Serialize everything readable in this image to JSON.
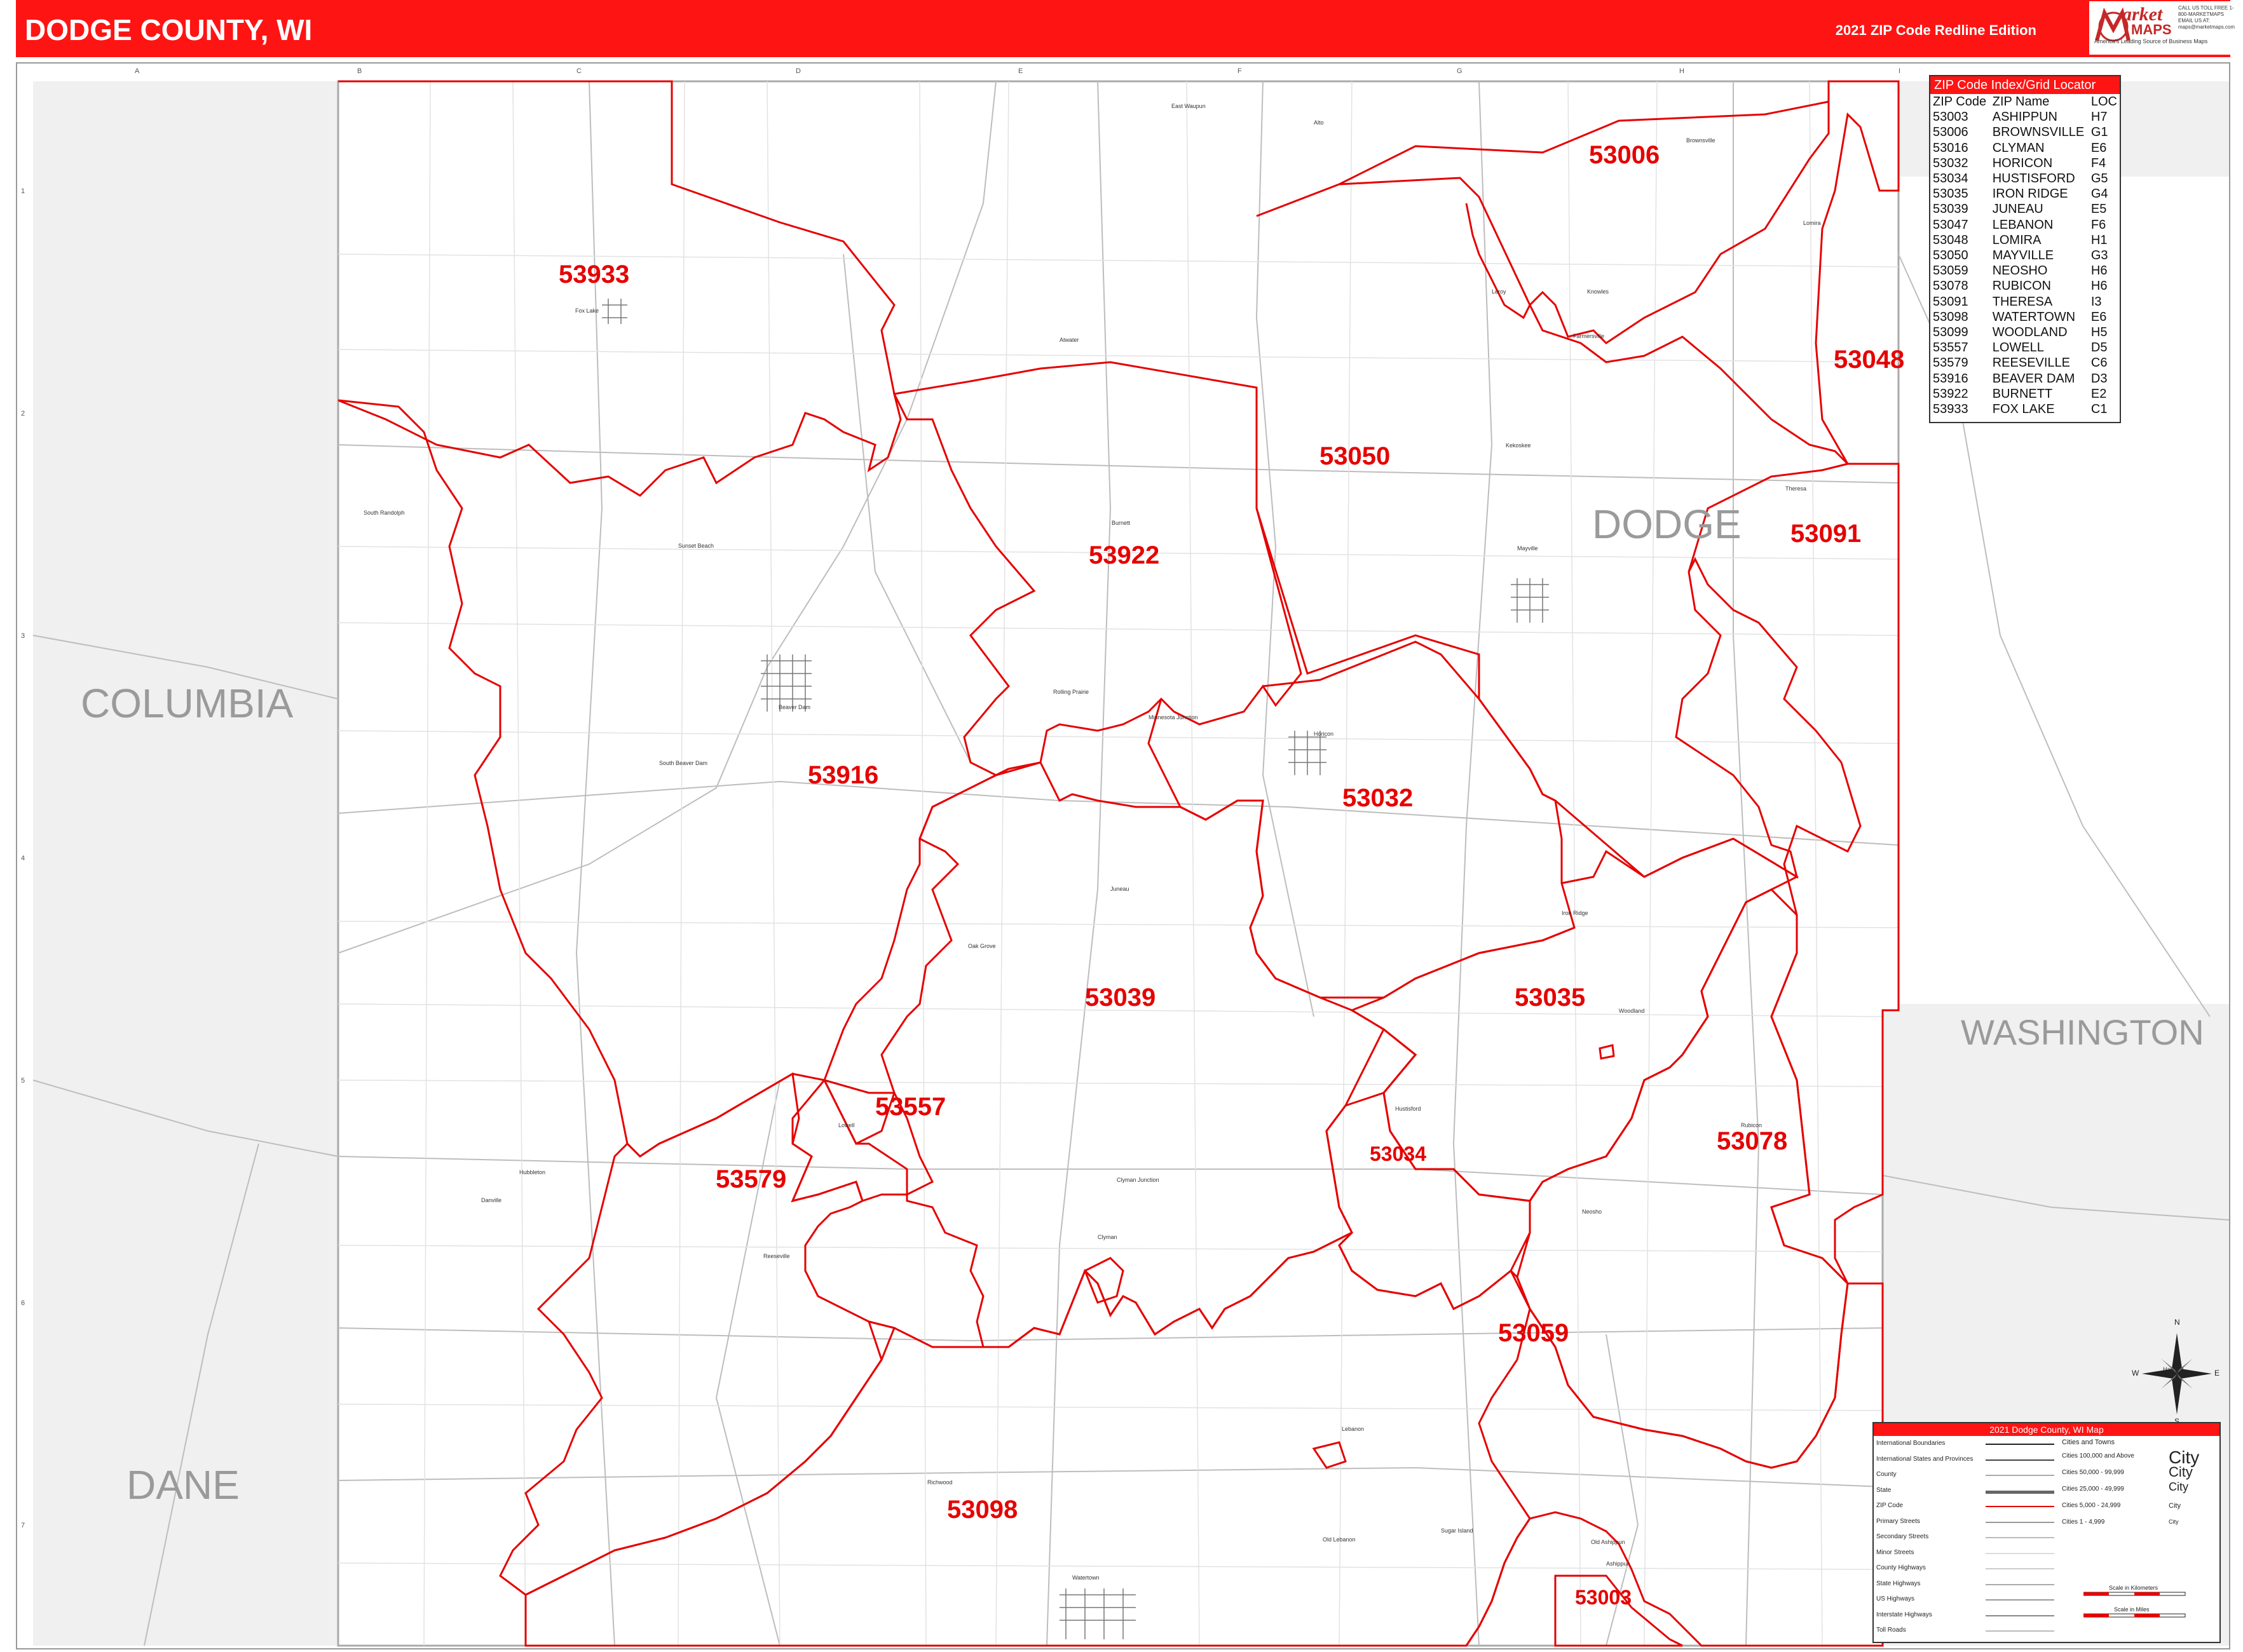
{
  "header": {
    "title": "DODGE COUNTY, WI",
    "edition": "2021 ZIP Code Redline Edition",
    "brand_word": "arket",
    "brand_maps": "MAPS",
    "brand_tagline": "America's Leading Source of Business Maps",
    "brand_info": "CALL US TOLL FREE 1-800-MARKETMAPS EMAIL US AT: maps@marketmaps.com"
  },
  "colors": {
    "accent": "#ff1414",
    "zip_boundary": "#e60000",
    "county_label": "#9a9a9a"
  },
  "counties": {
    "columbia": "COLUMBIA",
    "dodge": "DODGE",
    "washington": "WASHINGTON",
    "dane": "DANE"
  },
  "zips": [
    "53933",
    "53006",
    "53048",
    "53050",
    "53091",
    "53922",
    "53916",
    "53032",
    "53039",
    "53035",
    "53557",
    "53579",
    "53034",
    "53078",
    "53059",
    "53098",
    "53003"
  ],
  "cities": [
    "Fox Lake",
    "Beaver Dam",
    "South Beaver Dam",
    "South Randolph",
    "Sunset Beach",
    "Rolling Prairie",
    "Minnesota Junction",
    "Burnett",
    "Horicon",
    "Juneau",
    "Oak Grove",
    "Iron Ridge",
    "Mayville",
    "Theresa",
    "Lomira",
    "Brownsville",
    "Knowles",
    "Leroy",
    "Kekoskee",
    "Farmersville",
    "Neosho",
    "Rubicon",
    "Hustisford",
    "Clyman",
    "Clyman Junction",
    "Lowell",
    "Reeseville",
    "Danville",
    "Hubbleton",
    "Lebanon",
    "Old Lebanon",
    "Old Ashippun",
    "Ashippun",
    "Watertown",
    "Richwood",
    "Sugar Island",
    "East Waupun",
    "Alto",
    "Woodland",
    "Atwater",
    "Hartford"
  ],
  "grid": {
    "columns": [
      "A",
      "B",
      "C",
      "D",
      "E",
      "F",
      "G",
      "H",
      "I"
    ],
    "rows": [
      "1",
      "2",
      "3",
      "4",
      "5",
      "6",
      "7"
    ]
  },
  "index": {
    "title": "ZIP Code Index/Grid Locator",
    "headers": [
      "ZIP Code",
      "ZIP Name",
      "LOC"
    ],
    "rows": [
      [
        "53003",
        "ASHIPPUN",
        "H7"
      ],
      [
        "53006",
        "BROWNSVILLE",
        "G1"
      ],
      [
        "53016",
        "CLYMAN",
        "E6"
      ],
      [
        "53032",
        "HORICON",
        "F4"
      ],
      [
        "53034",
        "HUSTISFORD",
        "G5"
      ],
      [
        "53035",
        "IRON RIDGE",
        "G4"
      ],
      [
        "53039",
        "JUNEAU",
        "E5"
      ],
      [
        "53047",
        "LEBANON",
        "F6"
      ],
      [
        "53048",
        "LOMIRA",
        "H1"
      ],
      [
        "53050",
        "MAYVILLE",
        "G3"
      ],
      [
        "53059",
        "NEOSHO",
        "H6"
      ],
      [
        "53078",
        "RUBICON",
        "H6"
      ],
      [
        "53091",
        "THERESA",
        "I3"
      ],
      [
        "53098",
        "WATERTOWN",
        "E6"
      ],
      [
        "53099",
        "WOODLAND",
        "H5"
      ],
      [
        "53557",
        "LOWELL",
        "D5"
      ],
      [
        "53579",
        "REESEVILLE",
        "C6"
      ],
      [
        "53916",
        "BEAVER DAM",
        "D3"
      ],
      [
        "53922",
        "BURNETT",
        "E2"
      ],
      [
        "53933",
        "FOX LAKE",
        "C1"
      ]
    ]
  },
  "legend": {
    "title": "2021 Dodge County, WI Map",
    "lines": [
      "International Boundaries",
      "International States and Provinces",
      "County",
      "State",
      "ZIP Code",
      "Primary Streets",
      "Secondary Streets",
      "Minor Streets",
      "County Highways",
      "State Highways",
      "US Highways",
      "Interstate Highways",
      "Toll Roads"
    ],
    "city_header": "Cities and Towns",
    "city_sizes": [
      "Cities 100,000 and Above",
      "Cities 50,000 - 99,999",
      "Cities 25,000 - 49,999",
      "Cities 5,000 - 24,999",
      "Cities 1 - 4,999"
    ],
    "city_sample": "City",
    "scale_km": "Scale in Kilometers",
    "scale_mi": "Scale in Miles"
  },
  "compass": {
    "n": "N",
    "s": "S",
    "e": "E",
    "w": "W"
  }
}
